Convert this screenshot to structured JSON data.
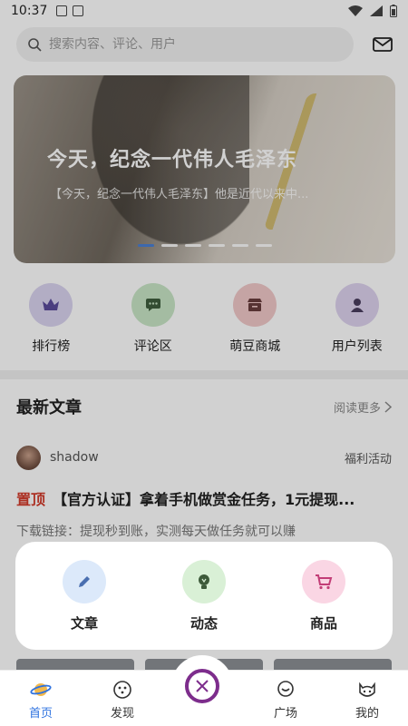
{
  "status": {
    "time": "10:37"
  },
  "search": {
    "placeholder": "搜索内容、评论、用户"
  },
  "banner": {
    "title": "今天，纪念一代伟人毛泽东",
    "subtitle": "【今天，纪念一代伟人毛泽东】他是近代以来中..."
  },
  "quick": [
    {
      "label": "排行榜",
      "icon": "crown-icon",
      "bg": "#d9d3ef",
      "fg": "#5b4b9c"
    },
    {
      "label": "评论区",
      "icon": "chat-icon",
      "bg": "#c8e6c6",
      "fg": "#3f5e3d"
    },
    {
      "label": "萌豆商城",
      "icon": "shop-icon",
      "bg": "#f1c9c9",
      "fg": "#6a3d3d"
    },
    {
      "label": "用户列表",
      "icon": "user-icon",
      "bg": "#ddd2ee",
      "fg": "#4a3d5e"
    }
  ],
  "latest": {
    "title": "最新文章",
    "read_more": "阅读更多"
  },
  "article": {
    "author": "shadow",
    "tag": "福利活动",
    "pin": "置顶",
    "title": "【官方认证】拿着手机做赏金任务，1元提现...",
    "body": "下载链接：提现秒到账，实测每天做任务就可以赚"
  },
  "popup": [
    {
      "label": "文章",
      "icon": "pencil-icon",
      "bg": "#dce9fa",
      "fg": "#4a6fb0"
    },
    {
      "label": "动态",
      "icon": "bulb-icon",
      "bg": "#d9f0d6",
      "fg": "#3d5a3a"
    },
    {
      "label": "商品",
      "icon": "cart-icon",
      "bg": "#fad6e4",
      "fg": "#c23e77"
    }
  ],
  "tabs": [
    {
      "label": "首页"
    },
    {
      "label": "发现"
    },
    {
      "label": "广场"
    },
    {
      "label": "我的"
    }
  ],
  "colors": {
    "accent": "#2f73e0",
    "pin": "#d23b2b",
    "center_ring": "#7d2d8c"
  }
}
